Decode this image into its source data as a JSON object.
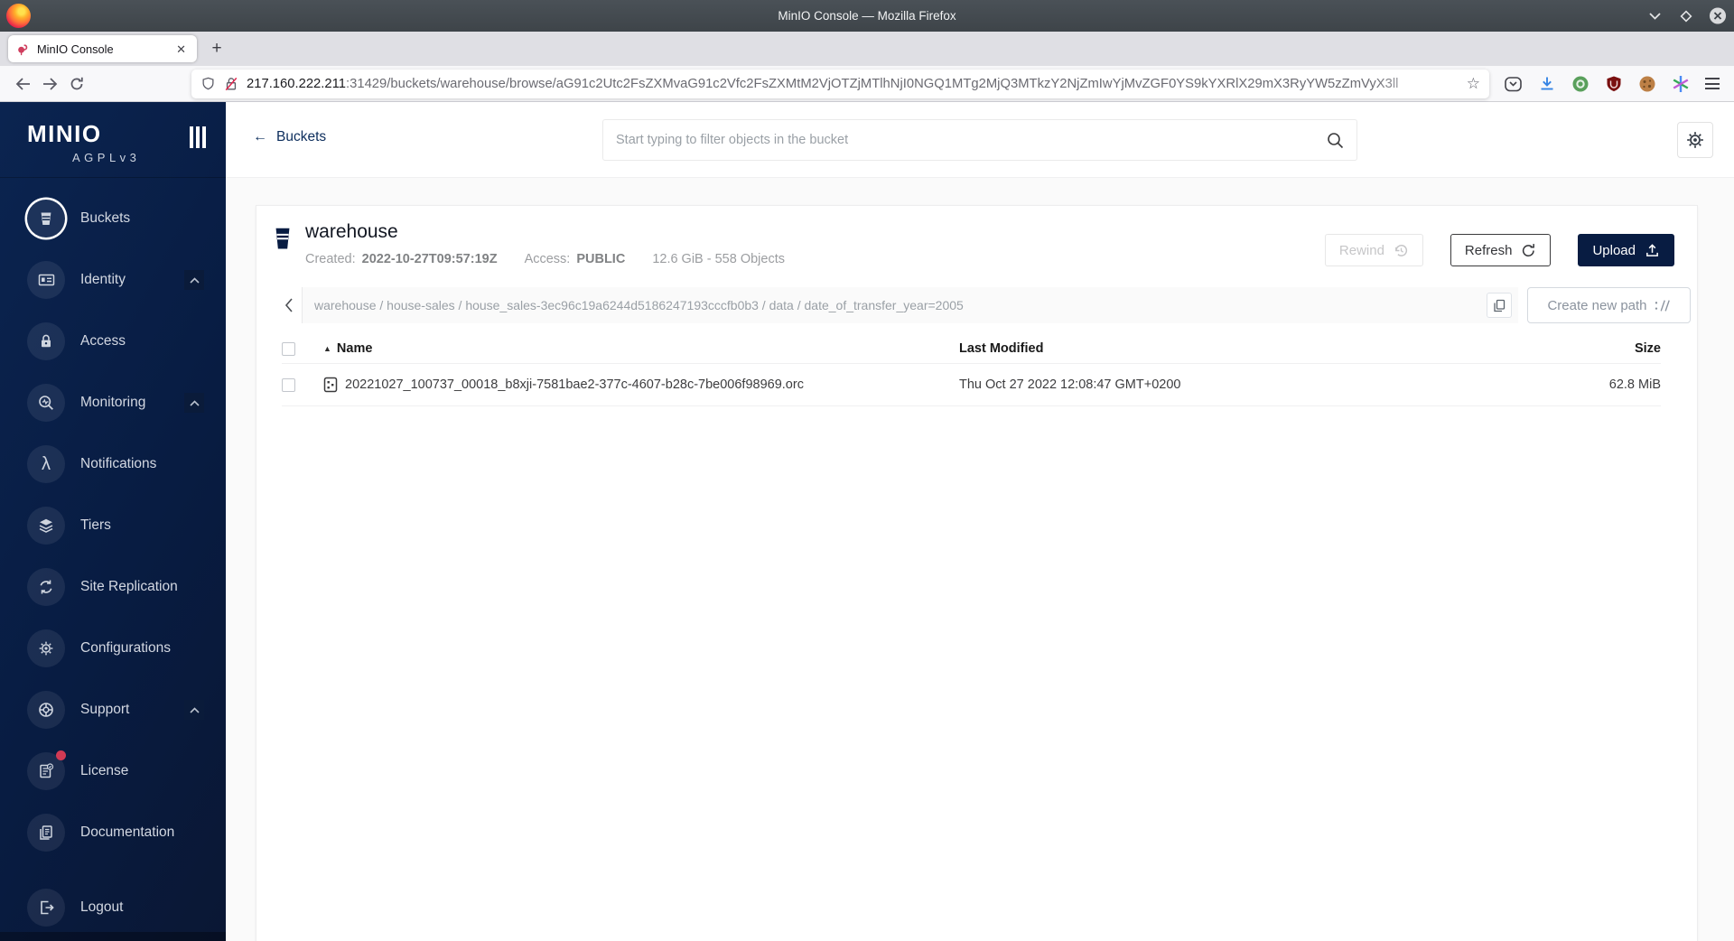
{
  "titlebar": {
    "title": "MinIO Console — Mozilla Firefox"
  },
  "tabbar": {
    "tab_title": "MinIO Console"
  },
  "toolbar": {
    "url_host": "217.160.222.211",
    "url_path": ":31429/buckets/warehouse/browse/aG91c2Utc2FsZXMvaG91c2Vfc2FsZXMtM2VjOTZjMTlhNjI0NGQ1MTg2MjQ3MTkzY2NjZmIwYjMvZGF0YS9kYXRlX29mX3RyYW5zZmVyX3ll"
  },
  "glyphs": {
    "close_tab": "✕",
    "new_tab": "+",
    "star": "☆",
    "back_arrow": "←",
    "sort_asc": "▲",
    "lambda": "λ"
  },
  "sidebar": {
    "logo": "MINIO",
    "logo_sub": "AGPLv3",
    "items": [
      {
        "label": "Buckets",
        "icon": "bucket-icon",
        "selected": true
      },
      {
        "label": "Identity",
        "icon": "identity-card-icon",
        "caret": true
      },
      {
        "label": "Access",
        "icon": "lock-icon"
      },
      {
        "label": "Monitoring",
        "icon": "monitoring-icon",
        "caret": true
      },
      {
        "label": "Notifications",
        "icon": "lambda-icon"
      },
      {
        "label": "Tiers",
        "icon": "layers-icon"
      },
      {
        "label": "Site Replication",
        "icon": "replication-icon"
      },
      {
        "label": "Configurations",
        "icon": "gear-icon"
      },
      {
        "label": "Support",
        "icon": "support-icon",
        "caret": true
      },
      {
        "label": "License",
        "icon": "license-icon",
        "badge": true
      },
      {
        "label": "Documentation",
        "icon": "documentation-icon"
      },
      {
        "label": "Logout",
        "icon": "logout-icon"
      }
    ]
  },
  "header": {
    "back_label": "Buckets",
    "search_placeholder": "Start typing to filter objects in the bucket"
  },
  "bucket": {
    "name": "warehouse",
    "created_label": "Created:",
    "created": "2022-10-27T09:57:19Z",
    "access_label": "Access:",
    "access": "PUBLIC",
    "usage": "12.6 GiB - 558 Objects",
    "actions": {
      "rewind": "Rewind",
      "refresh": "Refresh",
      "upload": "Upload"
    }
  },
  "browser": {
    "breadcrumb": "warehouse / house-sales / house_sales-3ec96c19a6244d5186247193cccfb0b3 / data / date_of_transfer_year=2005",
    "create_path_label": "Create new path",
    "table": {
      "columns": [
        "Name",
        "Last Modified",
        "Size"
      ],
      "rows": [
        {
          "name": "20221027_100737_00018_b8xji-7581bae2-377c-4607-b28c-7be006f98969.orc",
          "modified": "Thu Oct 27 2022 12:08:47 GMT+0200",
          "size": "62.8 MiB"
        }
      ]
    }
  },
  "colors": {
    "brand_navy": "#081c42",
    "badge_red": "#d13a54",
    "download_blue": "#3584e4",
    "ublock_red": "#7a1010"
  }
}
